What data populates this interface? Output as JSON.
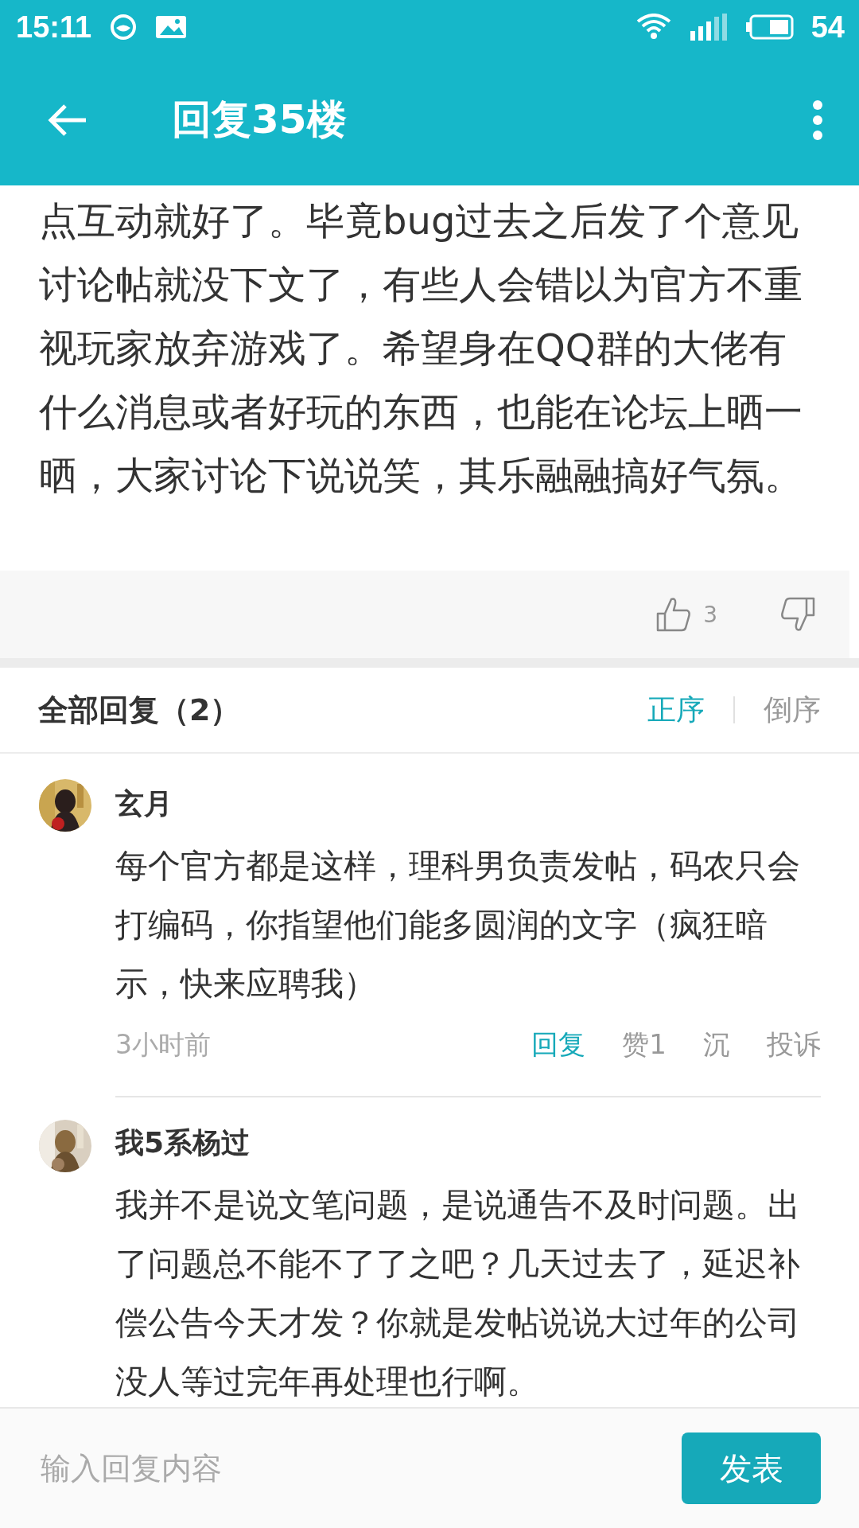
{
  "status_bar": {
    "time": "15:11",
    "battery": "54"
  },
  "toolbar": {
    "title": "回复35楼"
  },
  "post": {
    "text": "点互动就好了。毕竟bug过去之后发了个意见讨论帖就没下文了，有些人会错以为官方不重视玩家放弃游戏了。希望身在QQ群的大佬有什么消息或者好玩的东西，也能在论坛上晒一晒，大家讨论下说说笑，其乐融融搞好气氛。",
    "likes": "3"
  },
  "replies_header": {
    "title": "全部回复（2）",
    "sort": [
      {
        "label": "正序",
        "selected": true
      },
      {
        "label": "倒序",
        "selected": false
      }
    ]
  },
  "comments": [
    {
      "name": "玄月",
      "text": "每个官方都是这样，理科男负责发帖，码农只会打编码，你指望他们能多圆润的文字（疯狂暗示，快来应聘我）",
      "time": "3小时前",
      "actions": [
        {
          "kind": "reply",
          "label": "回复"
        },
        {
          "kind": "plain",
          "label": "赞1"
        },
        {
          "kind": "plain",
          "label": "沉"
        },
        {
          "kind": "plain",
          "label": "投诉"
        }
      ]
    },
    {
      "name": "我5系杨过",
      "text": "我并不是说文笔问题，是说通告不及时问题。出了问题总不能不了了之吧？几天过去了，延迟补偿公告今天才发？你就是发帖说说大过年的公司没人等过完年再处理也行啊。"
    }
  ],
  "composer": {
    "placeholder": "输入回复内容",
    "submit": "发表"
  }
}
